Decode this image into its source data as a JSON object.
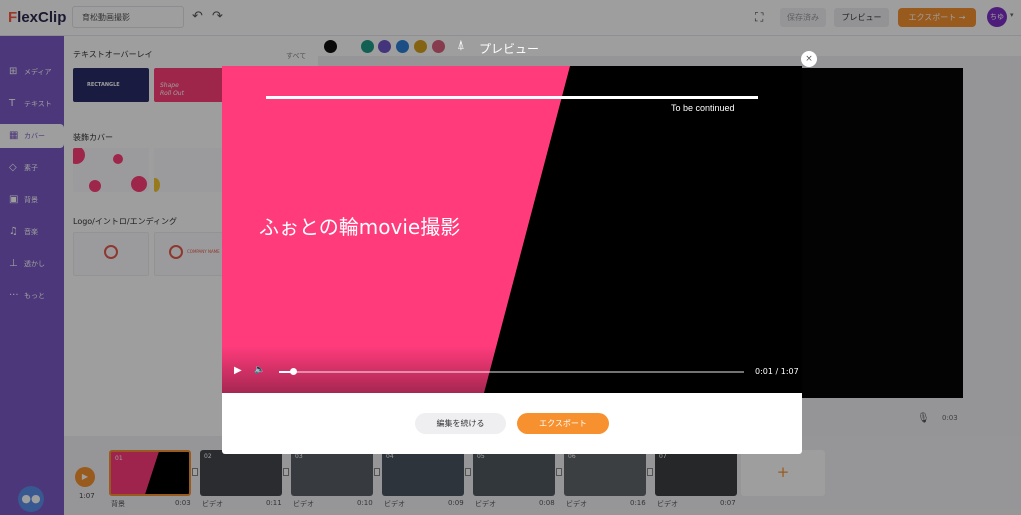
{
  "app": {
    "logo_f": "F",
    "logo_rest": "lexClip"
  },
  "header": {
    "project_title": "育松動画撮影",
    "saved_label": "保存済み",
    "preview_label": "プレビュー",
    "export_label": "エクスポート →",
    "user_initials": "ちゆ"
  },
  "sidebar": {
    "items": [
      {
        "label": "メディア",
        "icon": "media-icon"
      },
      {
        "label": "テキスト",
        "icon": "text-icon"
      },
      {
        "label": "カバー",
        "icon": "cover-icon"
      },
      {
        "label": "素子",
        "icon": "elements-icon"
      },
      {
        "label": "背景",
        "icon": "background-icon"
      },
      {
        "label": "音楽",
        "icon": "music-icon"
      },
      {
        "label": "透かし",
        "icon": "watermark-icon"
      },
      {
        "label": "もっと",
        "icon": "more-icon"
      }
    ],
    "active_index": 2
  },
  "panel": {
    "sections": [
      {
        "title": "テキストオーバーレイ",
        "see_all": "すべて"
      },
      {
        "title": "装飾カバー"
      },
      {
        "title": "Logo/イントロ/エンディング"
      }
    ],
    "thumbs": {
      "rect_label": "RECTANGLE",
      "shapes_label_1": "Shape",
      "shapes_label_2": "Roll Out",
      "logo2_label": "COMPANY NAME"
    }
  },
  "colorbar": {
    "swatches": [
      "#111111",
      "#1d9c87",
      "#6c55c9",
      "#2a7fd6",
      "#d6a11d",
      "#d9607f"
    ]
  },
  "canvas": {
    "time": "0:03"
  },
  "timeline": {
    "total": "1:07",
    "clips": [
      {
        "num": "01",
        "label": "背景",
        "duration": "0:03"
      },
      {
        "num": "02",
        "label": "ビデオ",
        "duration": "0:11"
      },
      {
        "num": "03",
        "label": "ビデオ",
        "duration": "0:10"
      },
      {
        "num": "04",
        "label": "ビデオ",
        "duration": "0:09"
      },
      {
        "num": "05",
        "label": "ビデオ",
        "duration": "0:08"
      },
      {
        "num": "06",
        "label": "ビデオ",
        "duration": "0:16"
      },
      {
        "num": "07",
        "label": "ビデオ",
        "duration": "0:07"
      }
    ],
    "add_label": "+"
  },
  "modal": {
    "title": "プレビュー",
    "close_label": "×",
    "video": {
      "to_be_continued": "To be continued",
      "title_text": "ふぉとの輪movie撮影",
      "time": "0:01 / 1:07",
      "progress": 0.03,
      "pink": "#ff3b7c"
    },
    "edit_label": "編集を続ける",
    "export_label": "エクスポート"
  }
}
